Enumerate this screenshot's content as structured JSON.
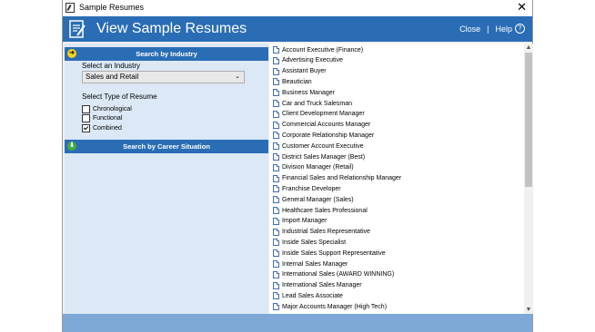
{
  "window": {
    "title": "Sample Resumes"
  },
  "header": {
    "title": "View Sample Resumes",
    "close_label": "Close",
    "separator": "|",
    "help_label": "Help",
    "help_icon_glyph": "?"
  },
  "colors": {
    "header_blue": "#2a6db5",
    "panel_bg": "#dce8f6",
    "footer_blue": "#7ea8d6"
  },
  "left_panel": {
    "search_by_industry": "Search by Industry",
    "industry_label": "Select an Industry",
    "industry_selected": "Sales and Retail",
    "type_label": "Select Type of Resume",
    "resume_types": [
      {
        "label": "Chronological",
        "checked": false
      },
      {
        "label": "Functional",
        "checked": false
      },
      {
        "label": "Combined",
        "checked": true
      }
    ],
    "search_by_career": "Search by Career Situation"
  },
  "resume_list": [
    "Account Executive (Finance)",
    "Advertising Executive",
    "Assistant Buyer",
    "Beautician",
    "Business Manager",
    "Car and Truck Salesman",
    "Client Development Manager",
    "Commercial Accounts Manager",
    "Corporate Relationship Manager",
    "Customer Account Executive",
    "District Sales Manager (Best)",
    "Division Manager (Retail)",
    "Financial Sales and Relationship Manager",
    "Franchise Developer",
    "General Manager (Sales)",
    "Healthcare Sales Professional",
    "Import Manager",
    "Industrial Sales Representative",
    "Inside Sales Specialist",
    "Inside Sales Support Representative",
    "Internal Sales Manager",
    "International Sales (AWARD WINNING)",
    "International Sales Manager",
    "Lead Sales Associate",
    "Major Accounts Manager (High Tech)"
  ]
}
